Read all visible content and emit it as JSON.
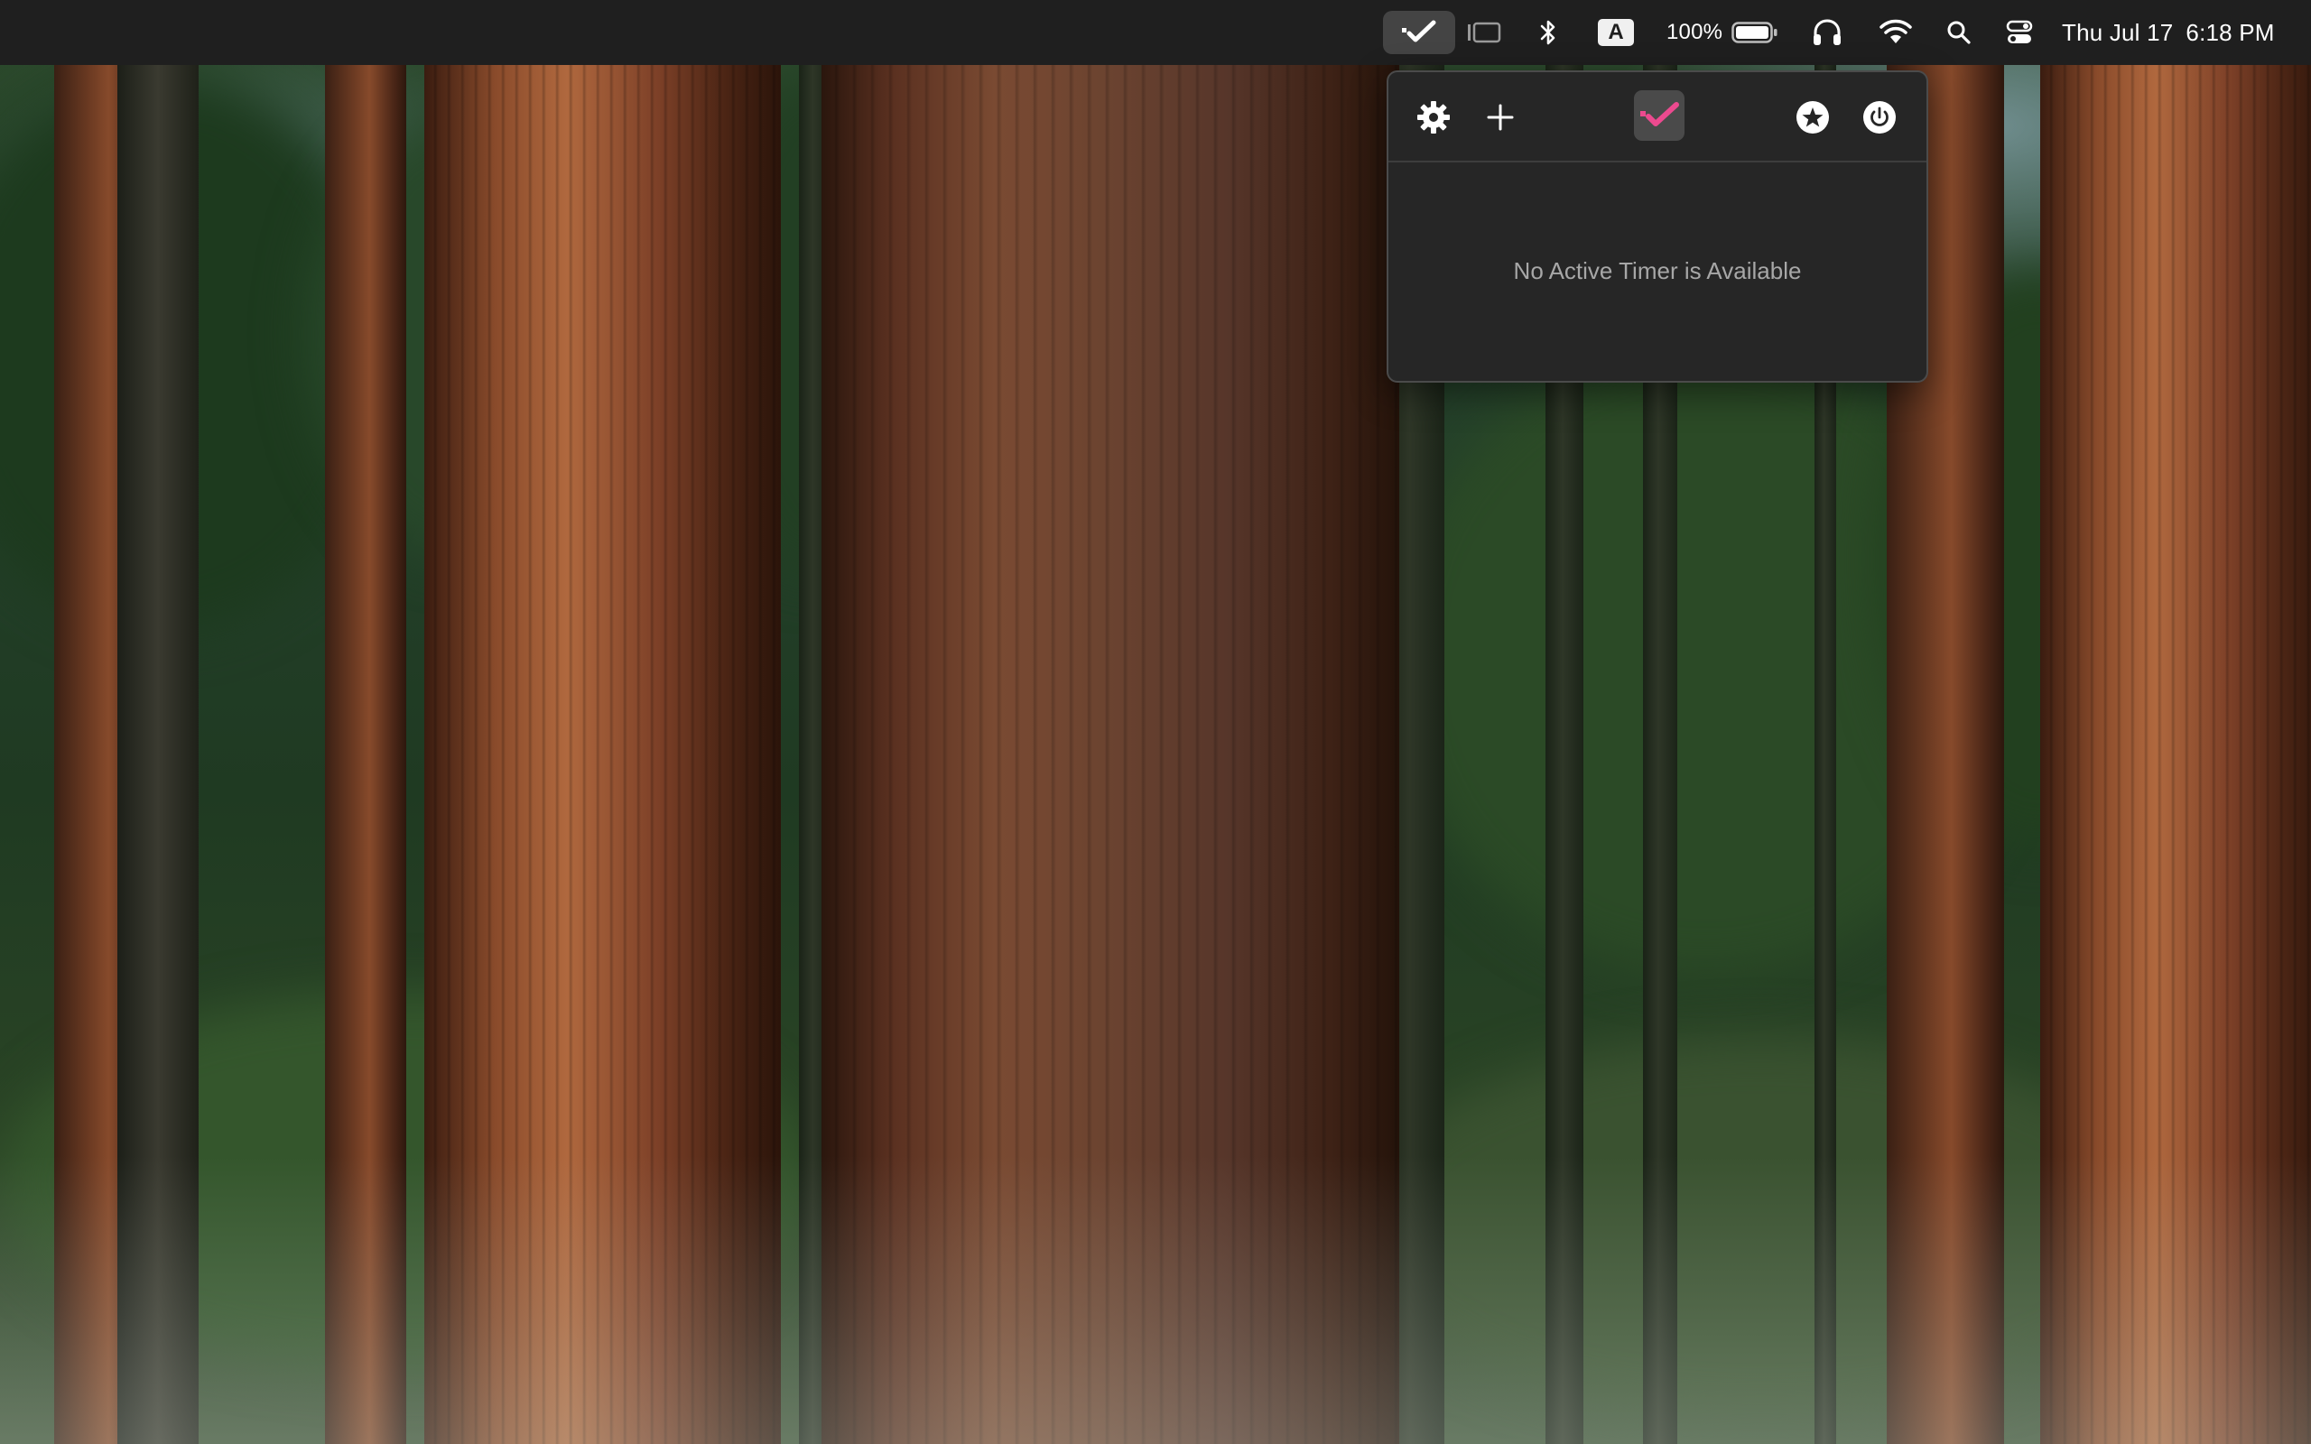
{
  "menubar": {
    "battery_percent": "100%",
    "battery_level": 1.0,
    "input_source": "A",
    "date": "Thu Jul 17",
    "time": "6:18 PM",
    "icons": [
      "timer-app-checkmark-icon",
      "stage-manager-icon",
      "bluetooth-icon",
      "input-source-icon",
      "battery-icon",
      "headphones-icon",
      "wifi-icon",
      "spotlight-search-icon",
      "control-center-icon"
    ]
  },
  "popover": {
    "header_icons": [
      "gear-icon",
      "plus-icon",
      "app-logo-checkmark-icon",
      "star-icon",
      "power-icon"
    ],
    "empty_message": "No Active Timer is Available",
    "accent_color": "#ec4a8f"
  },
  "wallpaper": {
    "subject": "forest"
  }
}
